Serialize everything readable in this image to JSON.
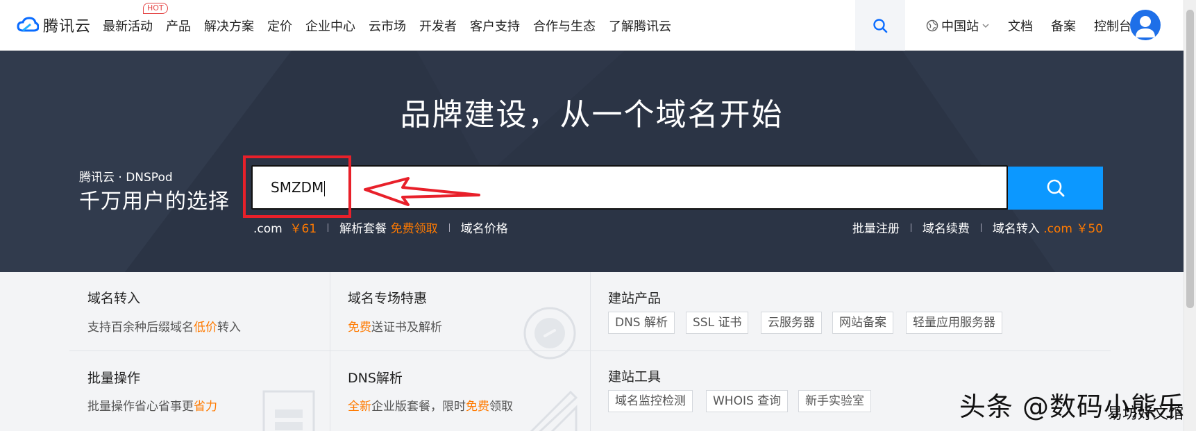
{
  "header": {
    "logo_text": "腾讯云",
    "nav": [
      "最新活动",
      "产品",
      "解决方案",
      "定价",
      "企业中心",
      "云市场",
      "开发者",
      "客户支持",
      "合作与生态",
      "了解腾讯云"
    ],
    "hot_badge": "HOT",
    "region": "中国站",
    "docs": "文档",
    "filing": "备案",
    "console": "控制台"
  },
  "hero": {
    "title": "品牌建设，从一个域名开始",
    "brand_sub": "腾讯云 · DNSPod",
    "brand_main": "千万用户的选择",
    "search_value": "SMZDM",
    "hint_left": {
      "com_label": ".com",
      "com_price": "￥61",
      "parse_label": "解析套餐",
      "parse_free": "免费领取",
      "price_link": "域名价格"
    },
    "hint_right": {
      "bulk": "批量注册",
      "renew": "域名续费",
      "transfer": "域名转入",
      "transfer_price": ".com ￥50"
    }
  },
  "lower": {
    "transfer": {
      "title": "域名转入",
      "desc_pre": "支持百余种后缀域名",
      "desc_hl": "低价",
      "desc_post": "转入"
    },
    "special": {
      "title": "域名专场特惠",
      "desc_hl": "免费",
      "desc_post": "送证书及解析"
    },
    "site_products": {
      "title": "建站产品",
      "tags": [
        "DNS 解析",
        "SSL 证书",
        "云服务器",
        "网站备案",
        "轻量应用服务器"
      ]
    },
    "bulk": {
      "title": "批量操作",
      "desc_pre": "批量操作省心省事更",
      "desc_hl": "省力"
    },
    "dns": {
      "title": "DNS解析",
      "desc_hl1": "全新",
      "desc_mid": "企业版套餐，限时",
      "desc_hl2": "免费",
      "desc_post": "领取"
    },
    "site_tools": {
      "title": "建站工具",
      "tags": [
        "域名监控检测",
        "WHOIS 查询",
        "新手实验室"
      ]
    }
  },
  "watermark": {
    "main": "头条 @数码小熊乐",
    "sub": "易坊好文馆"
  },
  "colors": {
    "accent": "#0c98ff",
    "hero_bg": "#2b3445",
    "highlight": "#ff7a00",
    "annotation": "#e8202a"
  }
}
